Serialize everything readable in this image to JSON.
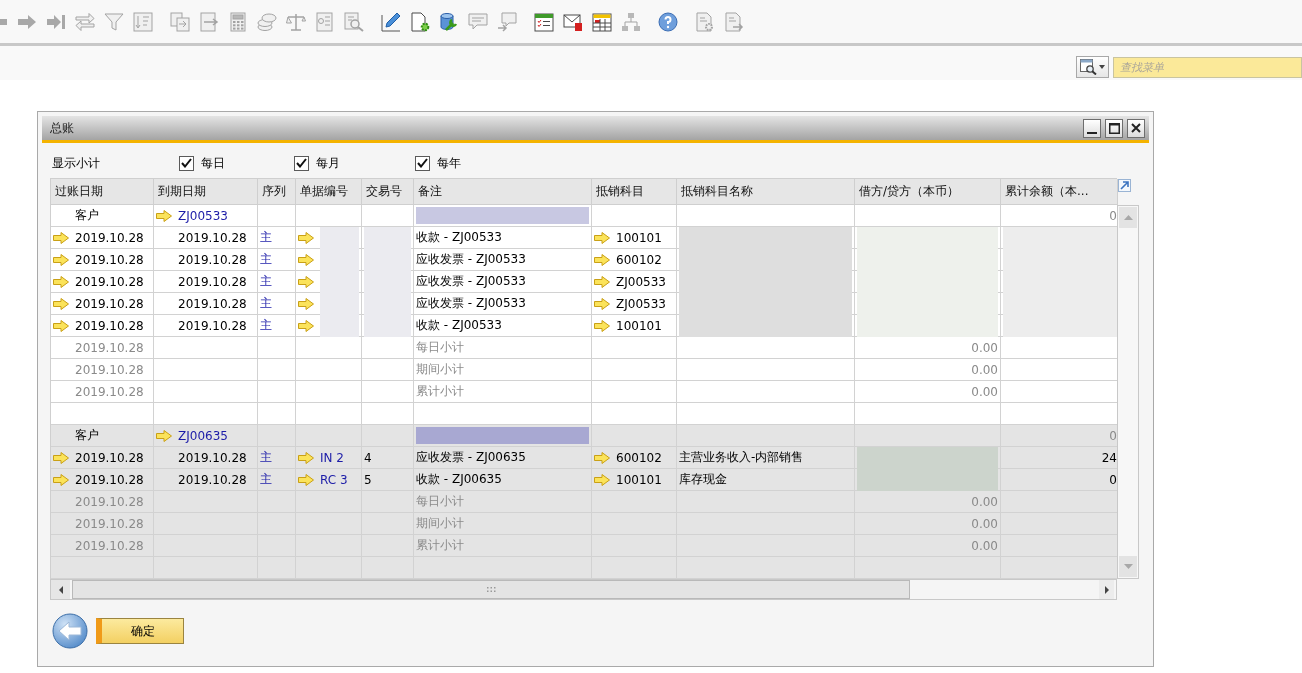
{
  "toolbar": {
    "groups": [
      [
        {
          "disabled": true
        },
        {
          "disabled": true
        },
        {
          "disabled": true
        },
        {
          "disabled": true
        },
        {
          "disabled": true
        },
        {
          "disabled": true
        }
      ],
      [
        {
          "disabled": true
        },
        {
          "disabled": true
        },
        {
          "disabled": true
        },
        {
          "disabled": true
        },
        {
          "disabled": true
        },
        {
          "disabled": true
        },
        {
          "disabled": true
        }
      ],
      [
        {
          "disabled": false
        },
        {
          "disabled": false
        },
        {
          "disabled": false
        },
        {
          "disabled": true
        },
        {
          "disabled": true
        }
      ],
      [
        {
          "disabled": false
        },
        {
          "disabled": false
        },
        {
          "disabled": false
        },
        {
          "disabled": true
        }
      ],
      [
        {
          "disabled": false
        }
      ],
      [
        {
          "disabled": true
        },
        {
          "disabled": true
        }
      ]
    ]
  },
  "search": {
    "placeholder": "查找菜单"
  },
  "window": {
    "title": "总账",
    "subtotals": {
      "label": "显示小计",
      "options": [
        {
          "label": "每日",
          "checked": true
        },
        {
          "label": "每月",
          "checked": true
        },
        {
          "label": "每年",
          "checked": true
        }
      ]
    },
    "table": {
      "columns": [
        "过账日期",
        "到期日期",
        "序列",
        "单据编号",
        "交易号",
        "备注",
        "抵销科目",
        "抵销科目名称",
        "借方/贷方（本币）",
        "累计余额（本..."
      ],
      "rows": [
        {
          "kind": "customer",
          "selected": false,
          "posting_date": "客户",
          "due_date": "ZJ00533",
          "balance": "0",
          "redacted": {
            "remarks": true
          }
        },
        {
          "kind": "entry",
          "selected": false,
          "posting_date": "2019.10.28",
          "due_date": "2019.10.28",
          "series": "主",
          "remarks": "收款 - ZJ00533",
          "offset_account": "100101",
          "redacted": {
            "doc_no": true,
            "trans_no": true,
            "offset_account_name": true,
            "debit_credit": true,
            "balance": true
          }
        },
        {
          "kind": "entry",
          "selected": false,
          "posting_date": "2019.10.28",
          "due_date": "2019.10.28",
          "series": "主",
          "remarks": "应收发票 - ZJ00533",
          "offset_account": "600102",
          "redacted": {
            "doc_no": true,
            "trans_no": true,
            "offset_account_name": true,
            "debit_credit": true,
            "balance": true
          }
        },
        {
          "kind": "entry",
          "selected": false,
          "posting_date": "2019.10.28",
          "due_date": "2019.10.28",
          "series": "主",
          "remarks": "应收发票 - ZJ00533",
          "offset_account": "ZJ00533",
          "redacted": {
            "doc_no": true,
            "trans_no": true,
            "offset_account_name": true,
            "debit_credit": true,
            "balance": true
          }
        },
        {
          "kind": "entry",
          "selected": false,
          "posting_date": "2019.10.28",
          "due_date": "2019.10.28",
          "series": "主",
          "remarks": "应收发票 - ZJ00533",
          "offset_account": "ZJ00533",
          "redacted": {
            "doc_no": true,
            "trans_no": true,
            "offset_account_name": true,
            "debit_credit": true,
            "balance": true
          }
        },
        {
          "kind": "entry",
          "selected": false,
          "posting_date": "2019.10.28",
          "due_date": "2019.10.28",
          "series": "主",
          "remarks": "收款 - ZJ00533",
          "offset_account": "100101",
          "redacted": {
            "doc_no": true,
            "trans_no": true,
            "offset_account_name": true,
            "debit_credit": true,
            "balance": true
          }
        },
        {
          "kind": "subtotal",
          "selected": false,
          "posting_date": "2019.10.28",
          "remarks": "每日小计",
          "debit_credit": "0.00"
        },
        {
          "kind": "subtotal",
          "selected": false,
          "posting_date": "2019.10.28",
          "remarks": "期间小计",
          "debit_credit": "0.00"
        },
        {
          "kind": "subtotal",
          "selected": false,
          "posting_date": "2019.10.28",
          "remarks": "累计小计",
          "debit_credit": "0.00"
        },
        {
          "kind": "blank",
          "selected": false
        },
        {
          "kind": "customer",
          "selected": true,
          "posting_date": "客户",
          "due_date": "ZJ00635",
          "balance": "0",
          "redacted": {
            "remarks": true
          }
        },
        {
          "kind": "entry",
          "selected": true,
          "posting_date": "2019.10.28",
          "due_date": "2019.10.28",
          "series": "主",
          "doc_no": "IN 2",
          "trans_no": "4",
          "remarks": "应收发票 - ZJ00635",
          "offset_account": "600102",
          "offset_account_name": "主营业务收入-内部销售",
          "balance": "24",
          "redacted": {
            "debit_credit": true
          }
        },
        {
          "kind": "entry",
          "selected": true,
          "posting_date": "2019.10.28",
          "due_date": "2019.10.28",
          "series": "主",
          "doc_no": "RC 3",
          "trans_no": "5",
          "remarks": "收款 - ZJ00635",
          "offset_account": "100101",
          "offset_account_name": "库存现金",
          "balance": "0",
          "redacted": {
            "debit_credit": true
          }
        },
        {
          "kind": "subtotal",
          "selected": true,
          "posting_date": "2019.10.28",
          "remarks": "每日小计",
          "debit_credit": "0.00"
        },
        {
          "kind": "subtotal",
          "selected": true,
          "posting_date": "2019.10.28",
          "remarks": "期间小计",
          "debit_credit": "0.00"
        },
        {
          "kind": "subtotal",
          "selected": true,
          "posting_date": "2019.10.28",
          "remarks": "累计小计",
          "debit_credit": "0.00"
        },
        {
          "kind": "blank",
          "selected": true
        }
      ]
    }
  },
  "ok_button": {
    "label": "确定"
  }
}
